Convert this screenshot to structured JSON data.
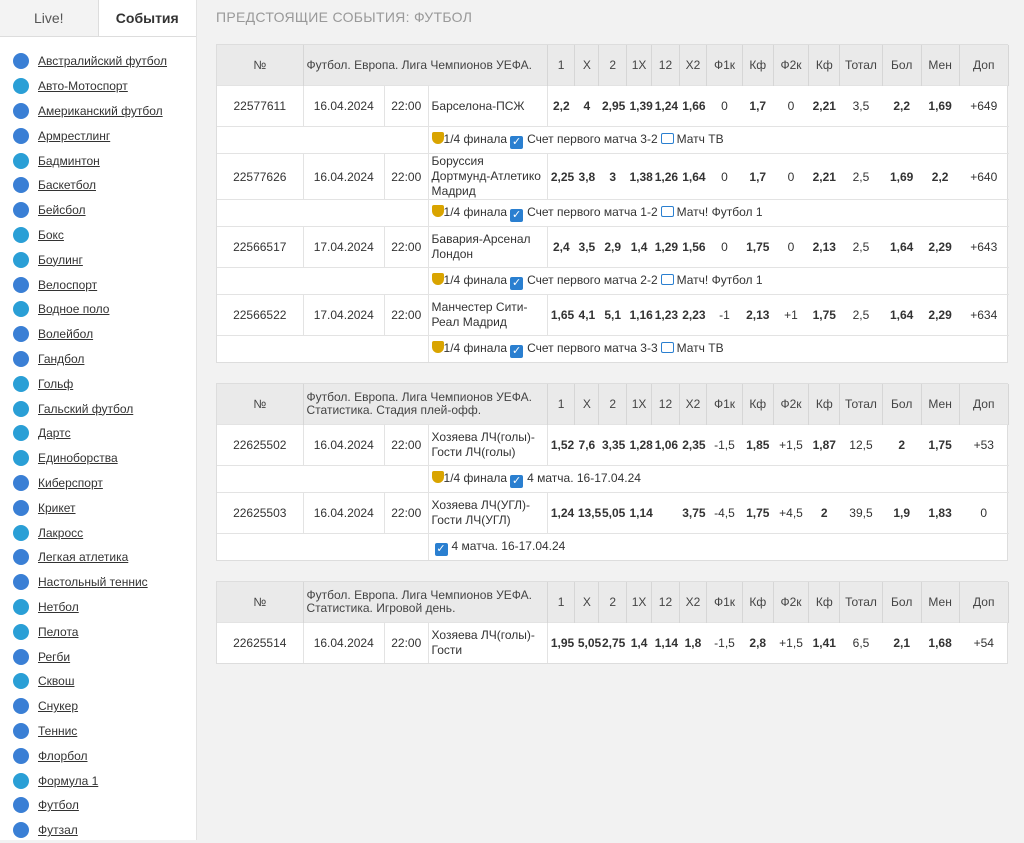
{
  "tabs": {
    "live": "Live!",
    "events": "События"
  },
  "sports": [
    {
      "name": "Австралийский футбол",
      "icon": "australian-football-icon",
      "color": "#3a7fd5"
    },
    {
      "name": "Авто-Мотоспорт",
      "icon": "motorsport-icon",
      "color": "#2a9fd6"
    },
    {
      "name": "Американский футбол",
      "icon": "american-football-icon",
      "color": "#3a7fd5"
    },
    {
      "name": "Армрестлинг",
      "icon": "armwrestling-icon",
      "color": "#3a7fd5"
    },
    {
      "name": "Бадминтон",
      "icon": "badminton-icon",
      "color": "#2a9fd6"
    },
    {
      "name": "Баскетбол",
      "icon": "basketball-icon",
      "color": "#3a7fd5"
    },
    {
      "name": "Бейсбол",
      "icon": "baseball-icon",
      "color": "#3a7fd5"
    },
    {
      "name": "Бокс",
      "icon": "boxing-icon",
      "color": "#2a9fd6"
    },
    {
      "name": "Боулинг",
      "icon": "bowling-icon",
      "color": "#2a9fd6"
    },
    {
      "name": "Велоспорт",
      "icon": "cycling-icon",
      "color": "#3a7fd5"
    },
    {
      "name": "Водное поло",
      "icon": "water-polo-icon",
      "color": "#2a9fd6"
    },
    {
      "name": "Волейбол",
      "icon": "volleyball-icon",
      "color": "#3a7fd5"
    },
    {
      "name": "Гандбол",
      "icon": "handball-icon",
      "color": "#3a7fd5"
    },
    {
      "name": "Гольф",
      "icon": "golf-icon",
      "color": "#2a9fd6"
    },
    {
      "name": "Гальский футбол",
      "icon": "gaelic-football-icon",
      "color": "#2a9fd6"
    },
    {
      "name": "Дартс",
      "icon": "darts-icon",
      "color": "#2a9fd6"
    },
    {
      "name": "Единоборства",
      "icon": "martial-arts-icon",
      "color": "#2a9fd6"
    },
    {
      "name": "Киберспорт",
      "icon": "esports-icon",
      "color": "#3a7fd5"
    },
    {
      "name": "Крикет",
      "icon": "cricket-icon",
      "color": "#3a7fd5"
    },
    {
      "name": "Лакросс",
      "icon": "lacrosse-icon",
      "color": "#2a9fd6"
    },
    {
      "name": "Легкая атлетика",
      "icon": "athletics-icon",
      "color": "#3a7fd5"
    },
    {
      "name": "Настольный теннис",
      "icon": "table-tennis-icon",
      "color": "#3a7fd5"
    },
    {
      "name": "Нетбол",
      "icon": "netball-icon",
      "color": "#2a9fd6"
    },
    {
      "name": "Пелота",
      "icon": "pelota-icon",
      "color": "#2a9fd6"
    },
    {
      "name": "Регби",
      "icon": "rugby-icon",
      "color": "#3a7fd5"
    },
    {
      "name": "Сквош",
      "icon": "squash-icon",
      "color": "#2a9fd6"
    },
    {
      "name": "Снукер",
      "icon": "snooker-icon",
      "color": "#3a7fd5"
    },
    {
      "name": "Теннис",
      "icon": "tennis-icon",
      "color": "#3a7fd5"
    },
    {
      "name": "Флорбол",
      "icon": "floorball-icon",
      "color": "#3a7fd5"
    },
    {
      "name": "Формула 1",
      "icon": "formula1-icon",
      "color": "#2a9fd6"
    },
    {
      "name": "Футбол",
      "icon": "football-icon",
      "color": "#3a7fd5"
    },
    {
      "name": "Футзал",
      "icon": "futsal-icon",
      "color": "#3a7fd5"
    }
  ],
  "page_title": "ПРЕДСТОЯЩИЕ СОБЫТИЯ: ФУТБОЛ",
  "odds_headers": [
    "1",
    "X",
    "2",
    "1X",
    "12",
    "X2",
    "Ф1к",
    "Кф",
    "Ф2к",
    "Кф",
    "Тотал",
    "Бол",
    "Мен",
    "Доп"
  ],
  "num_header": "№",
  "blocks": [
    {
      "league": "Футбол. Европа. Лига Чемпионов УЕФА.",
      "events": [
        {
          "id": "22577611",
          "date": "16.04.2024",
          "time": "22:00",
          "teams": "Барселона-ПСЖ",
          "odds": [
            "2,2",
            "4",
            "2,95",
            "1,39",
            "1,24",
            "1,66",
            "0",
            "1,7",
            "0",
            "2,21",
            "3,5",
            "2,2",
            "1,69",
            "+649"
          ],
          "info": {
            "stage": "1/4 финала",
            "note": "Счет первого матча 3-2",
            "tv": "Матч ТВ"
          }
        },
        {
          "id": "22577626",
          "date": "16.04.2024",
          "time": "22:00",
          "teams": "Боруссия Дортмунд-Атлетико Мадрид",
          "odds": [
            "2,25",
            "3,8",
            "3",
            "1,38",
            "1,26",
            "1,64",
            "0",
            "1,7",
            "0",
            "2,21",
            "2,5",
            "1,69",
            "2,2",
            "+640"
          ],
          "info": {
            "stage": "1/4 финала",
            "note": "Счет первого матча 1-2",
            "tv": "Матч! Футбол 1"
          }
        },
        {
          "id": "22566517",
          "date": "17.04.2024",
          "time": "22:00",
          "teams": "Бавария-Арсенал Лондон",
          "odds": [
            "2,4",
            "3,5",
            "2,9",
            "1,4",
            "1,29",
            "1,56",
            "0",
            "1,75",
            "0",
            "2,13",
            "2,5",
            "1,64",
            "2,29",
            "+643"
          ],
          "info": {
            "stage": "1/4 финала",
            "note": "Счет первого матча 2-2",
            "tv": "Матч! Футбол 1"
          }
        },
        {
          "id": "22566522",
          "date": "17.04.2024",
          "time": "22:00",
          "teams": "Манчестер Сити-Реал Мадрид",
          "odds": [
            "1,65",
            "4,1",
            "5,1",
            "1,16",
            "1,23",
            "2,23",
            "-1",
            "2,13",
            "+1",
            "1,75",
            "2,5",
            "1,64",
            "2,29",
            "+634"
          ],
          "info": {
            "stage": "1/4 финала",
            "note": "Счет первого матча 3-3",
            "tv": "Матч ТВ"
          }
        }
      ]
    },
    {
      "league": "Футбол. Европа. Лига Чемпионов УЕФА. Статистика. Стадия плей-офф.",
      "events": [
        {
          "id": "22625502",
          "date": "16.04.2024",
          "time": "22:00",
          "teams": "Хозяева ЛЧ(голы)-Гости ЛЧ(голы)",
          "odds": [
            "1,52",
            "7,6",
            "3,35",
            "1,28",
            "1,06",
            "2,35",
            "-1,5",
            "1,85",
            "+1,5",
            "1,87",
            "12,5",
            "2",
            "1,75",
            "+53"
          ],
          "info": {
            "stage": "1/4 финала",
            "note": "4 матча. 16-17.04.24",
            "tv": ""
          }
        },
        {
          "id": "22625503",
          "date": "16.04.2024",
          "time": "22:00",
          "teams": "Хозяева ЛЧ(УГЛ)-Гости ЛЧ(УГЛ)",
          "odds": [
            "1,24",
            "13,5",
            "5,05",
            "1,14",
            "",
            "3,75",
            "-4,5",
            "1,75",
            "+4,5",
            "2",
            "39,5",
            "1,9",
            "1,83",
            "0"
          ],
          "info": {
            "stage": "",
            "note": "4 матча. 16-17.04.24",
            "tv": ""
          }
        }
      ]
    },
    {
      "league": "Футбол. Европа. Лига Чемпионов УЕФА. Статистика. Игровой день.",
      "events": [
        {
          "id": "22625514",
          "date": "16.04.2024",
          "time": "22:00",
          "teams": "Хозяева ЛЧ(голы)-Гости",
          "odds": [
            "1,95",
            "5,05",
            "2,75",
            "1,4",
            "1,14",
            "1,8",
            "-1,5",
            "2,8",
            "+1,5",
            "1,41",
            "6,5",
            "2,1",
            "1,68",
            "+54"
          ],
          "info": null
        }
      ]
    }
  ]
}
